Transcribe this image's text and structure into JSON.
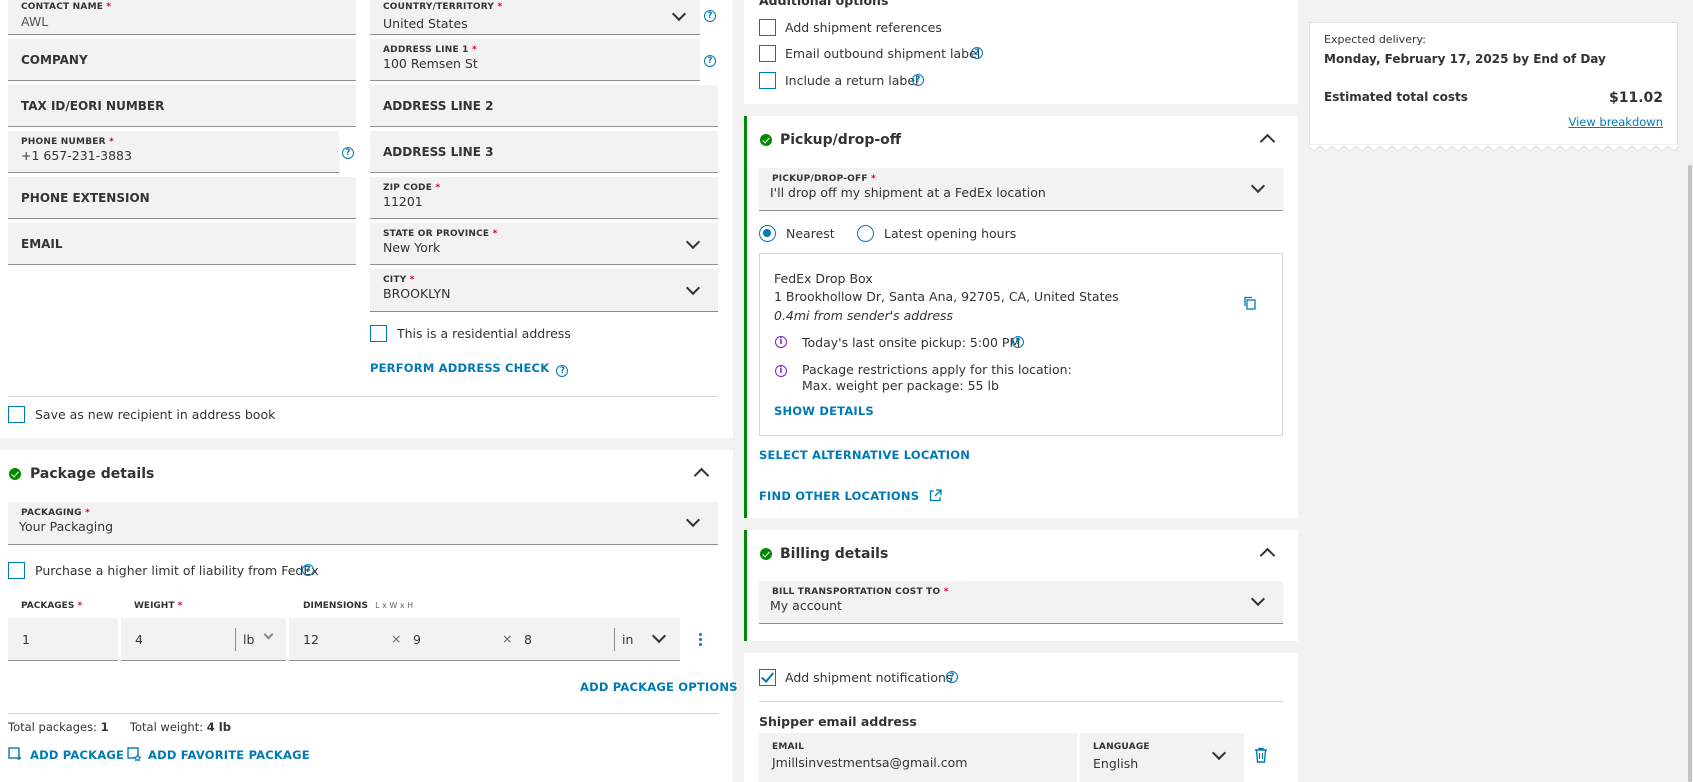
{
  "recipient": {
    "contact_name_label": "CONTACT NAME",
    "contact_name_value": "AWL",
    "company_label": "COMPANY",
    "tax_label": "TAX ID/EORI NUMBER",
    "phone_label": "PHONE NUMBER",
    "phone_value": "+1 657-231-3883",
    "phone_ext_label": "PHONE EXTENSION",
    "email_label": "EMAIL",
    "country_label": "COUNTRY/TERRITORY",
    "country_value": "United States",
    "addr1_label": "ADDRESS LINE 1",
    "addr1_value": "100 Remsen St",
    "addr2_label": "ADDRESS LINE 2",
    "addr3_label": "ADDRESS LINE 3",
    "zip_label": "ZIP CODE",
    "zip_value": "11201",
    "state_label": "STATE OR PROVINCE",
    "state_value": "New York",
    "city_label": "CITY",
    "city_value": "BROOKLYN",
    "residential_label": "This is a residential address",
    "address_check": "PERFORM ADDRESS CHECK",
    "save_recipient": "Save as new recipient in address book",
    "required_mark": "*"
  },
  "package": {
    "title": "Package details",
    "packaging_label": "PACKAGING",
    "packaging_value": "Your Packaging",
    "liability_label": "Purchase a higher limit of liability from FedEx",
    "packages_label": "PACKAGES",
    "weight_label": "WEIGHT",
    "dimensions_label": "DIMENSIONS",
    "dimensions_hint": "L x W x H",
    "packages_value": "1",
    "weight_value": "4",
    "weight_unit": "lb",
    "dim_l": "12",
    "dim_w": "9",
    "dim_h": "8",
    "dim_unit": "in",
    "times": "×",
    "add_options": "ADD PACKAGE OPTIONS",
    "total_packages_label": "Total packages:",
    "total_packages_value": "1",
    "total_weight_label": "Total weight:",
    "total_weight_value": "4 lb",
    "add_package": "ADD PACKAGE",
    "add_favorite": "ADD FAVORITE PACKAGE"
  },
  "additional": {
    "title": "Additional options",
    "references": "Add shipment references",
    "email_label": "Email outbound shipment label",
    "return_label": "Include a return label"
  },
  "pickup": {
    "title": "Pickup/drop-off",
    "field_label": "PICKUP/DROP-OFF",
    "field_value": "I'll drop off my shipment at a FedEx location",
    "radio_nearest": "Nearest",
    "radio_latest": "Latest opening hours",
    "location_name": "FedEx Drop Box",
    "location_address": "1 Brookhollow Dr, Santa Ana, 92705, CA, United States",
    "location_distance": "0.4mi from sender's address",
    "last_pickup": "Today's last onsite pickup: 5:00 PM",
    "restrictions_line1": "Package restrictions apply for this location:",
    "restrictions_line2": "Max. weight per package: 55 lb",
    "show_details": "SHOW DETAILS",
    "select_alt": "SELECT ALTERNATIVE LOCATION",
    "find_other": "FIND OTHER LOCATIONS"
  },
  "billing": {
    "title": "Billing details",
    "field_label": "BILL TRANSPORTATION COST TO",
    "field_value": "My account"
  },
  "notifications": {
    "add_label": "Add shipment notifications",
    "shipper_email_title": "Shipper email address",
    "email_label": "EMAIL",
    "email_value": "Jmillsinvestmentsa@gmail.com",
    "language_label": "LANGUAGE",
    "language_value": "English"
  },
  "summary": {
    "expected_label": "Expected delivery:",
    "expected_value": "Monday, February 17, 2025 by End of Day",
    "total_label": "Estimated total costs",
    "total_value": "$11.02",
    "breakdown": "View breakdown"
  },
  "colors": {
    "accent": "#007ab7",
    "success": "#008a00",
    "required": "#de002e",
    "info": "#7d22c3"
  }
}
